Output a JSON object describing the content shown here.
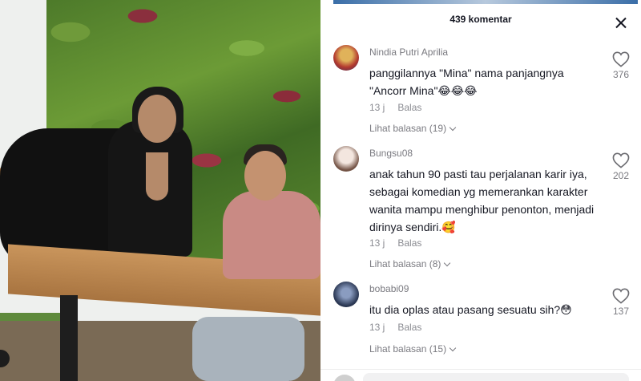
{
  "header": {
    "title": "439 komentar",
    "close_icon": "close-icon"
  },
  "colors": {
    "text": "#161823",
    "secondary": "#7a7a80",
    "background": "#ffffff"
  },
  "comments": [
    {
      "username": "Nindia Putri Aprilia",
      "text": "panggilannya \"Mina\" nama panjangnya \"Ancorr Mina\"😂😂😂",
      "time": "13 j",
      "reply_label": "Balas",
      "replies_label": "Lihat balasan (19)",
      "likes": "376"
    },
    {
      "username": "Bungsu08",
      "text": "anak tahun 90 pasti tau perjalanan karir iya, sebagai komedian yg memerankan karakter wanita mampu menghibur penonton, menjadi dirinya sendiri.🥰",
      "time": "13 j",
      "reply_label": "Balas",
      "replies_label": "Lihat balasan (8)",
      "likes": "202"
    },
    {
      "username": "bobabi09",
      "text": "itu dia oplas atau pasang sesuatu sih?😳",
      "time": "13 j",
      "reply_label": "Balas",
      "replies_label": "Lihat balasan (15)",
      "likes": "137"
    }
  ]
}
